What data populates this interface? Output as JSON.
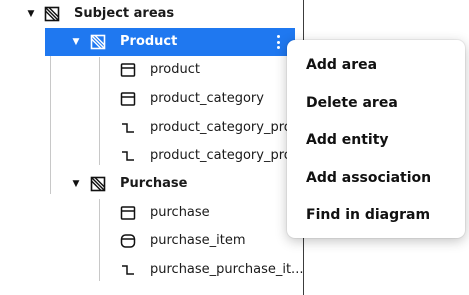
{
  "tree": {
    "root": {
      "label": "Subject areas",
      "icon": "area-icon"
    },
    "product_area": {
      "label": "Product",
      "icon": "area-icon",
      "selected": true,
      "children": [
        {
          "label": "product",
          "icon": "entity-table-icon"
        },
        {
          "label": "product_category",
          "icon": "entity-table-icon"
        },
        {
          "label": "product_category_pro...",
          "icon": "association-icon"
        },
        {
          "label": "product_category_pro...",
          "icon": "association-icon"
        }
      ]
    },
    "purchase_area": {
      "label": "Purchase",
      "icon": "area-icon",
      "children": [
        {
          "label": "purchase",
          "icon": "entity-table-icon"
        },
        {
          "label": "purchase_item",
          "icon": "entity-rounded-icon"
        },
        {
          "label": "purchase_purchase_it...",
          "icon": "association-icon"
        }
      ]
    }
  },
  "context_menu": {
    "items": [
      {
        "label": "Add area"
      },
      {
        "label": "Delete area"
      },
      {
        "label": "Add entity"
      },
      {
        "label": "Add association"
      },
      {
        "label": "Find in diagram"
      }
    ]
  },
  "colors": {
    "selection": "#1f78f0",
    "text": "#1a1a1a"
  }
}
